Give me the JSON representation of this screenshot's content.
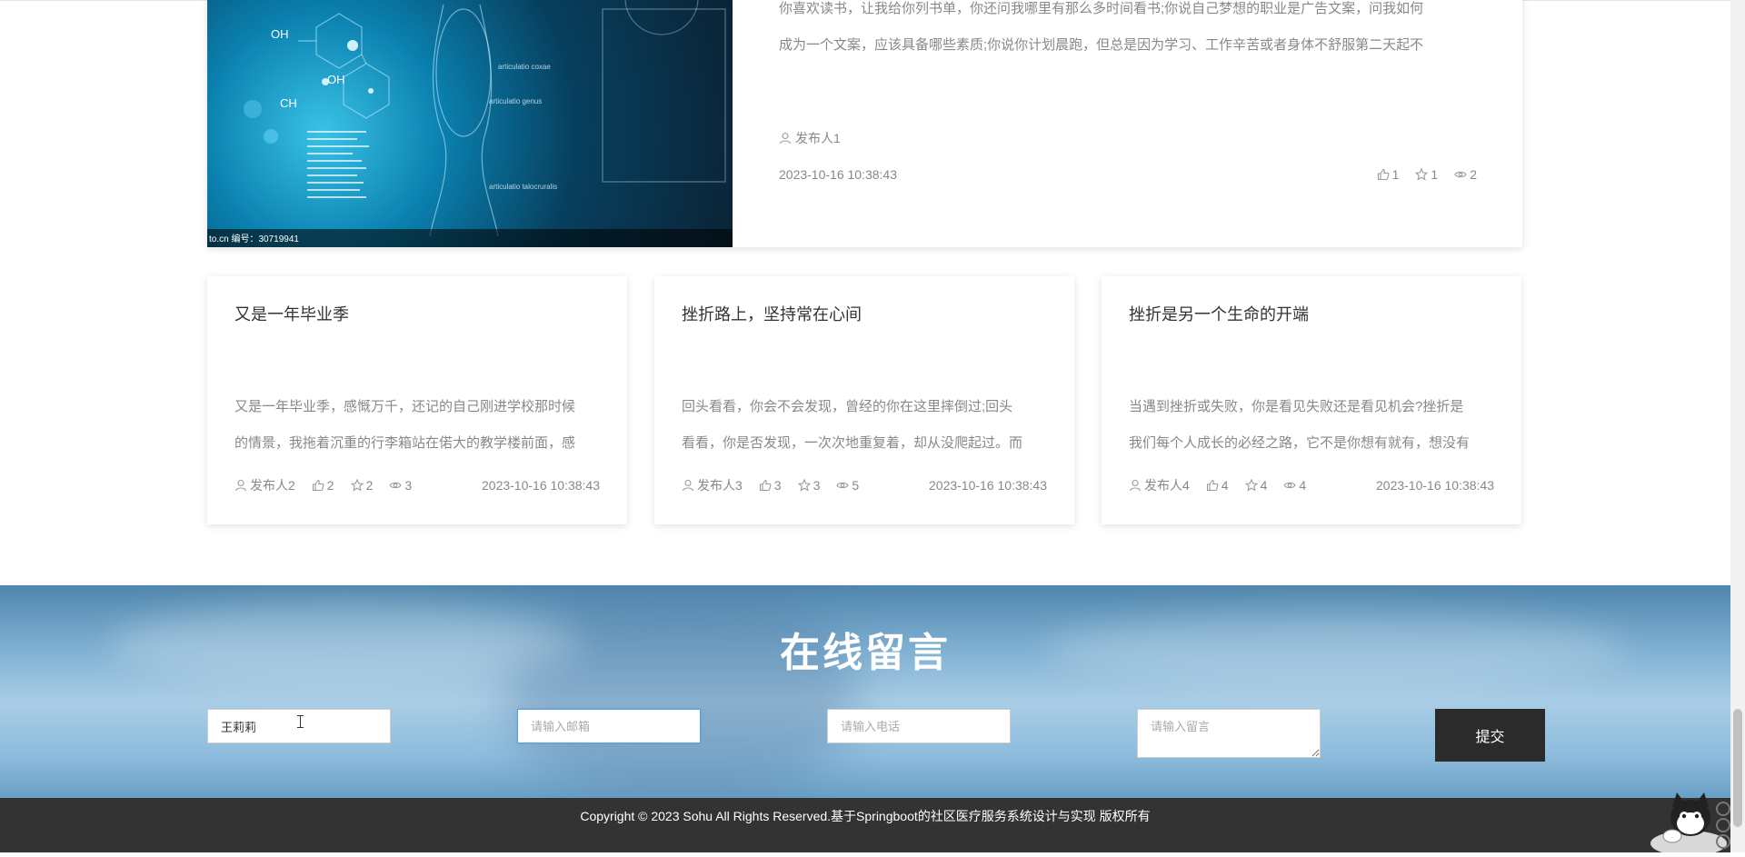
{
  "featured": {
    "text_lines": [
      "你喜欢读书，让我给你列书单，你还问我哪里有那么多时间看书;你说自己梦想的职业是广告文案，问我如何",
      "成为一个文案，应该具备哪些素质;你说你计划晨跑，但总是因为学习、工作辛苦或者身体不舒服第二天起不"
    ],
    "author": "发布人1",
    "date": "2023-10-16 10:38:43",
    "likes": "1",
    "favorites": "1",
    "views": "2",
    "image_caption": "to.cn  编号：30719941",
    "image_labels": [
      "OH",
      "OH",
      "CH",
      "articulatio coxae",
      "articulatio genus",
      "articulatio talocruralis"
    ]
  },
  "cards": [
    {
      "title": "又是一年毕业季",
      "desc_lines": [
        "又是一年毕业季，感慨万千，还记的自己刚进学校那时候",
        "的情景，我拖着沉重的行李箱站在偌大的教学楼前面，感"
      ],
      "author": "发布人2",
      "likes": "2",
      "favorites": "2",
      "views": "3",
      "date": "2023-10-16 10:38:43"
    },
    {
      "title": "挫折路上，坚持常在心间",
      "desc_lines": [
        "回头看看，你会不会发现，曾经的你在这里摔倒过;回头",
        "看看，你是否发现，一次次地重复着，却从没爬起过。而"
      ],
      "author": "发布人3",
      "likes": "3",
      "favorites": "3",
      "views": "5",
      "date": "2023-10-16 10:38:43"
    },
    {
      "title": "挫折是另一个生命的开端",
      "desc_lines": [
        "当遇到挫折或失败，你是看见失败还是看见机会?挫折是",
        "我们每个人成长的必经之路，它不是你想有就有，想没有"
      ],
      "author": "发布人4",
      "likes": "4",
      "favorites": "4",
      "views": "4",
      "date": "2023-10-16 10:38:43"
    }
  ],
  "message": {
    "title": "在线留言",
    "name_value": "王莉莉",
    "email_placeholder": "请输入邮箱",
    "phone_placeholder": "请输入电话",
    "content_placeholder": "请输入留言",
    "submit_label": "提交"
  },
  "footer": {
    "copyright": "Copyright © 2023 Sohu All Rights Reserved.基于Springboot的社区医疗服务系统设计与实现 版权所有"
  },
  "icons": {
    "author": "user-icon",
    "likes": "thumbs-up-icon",
    "favorites": "star-icon",
    "views": "eye-icon"
  },
  "colors": {
    "footer_bg": "#333333",
    "submit_bg": "#2b2b2b",
    "input_focus_border": "#5a9fd6"
  }
}
